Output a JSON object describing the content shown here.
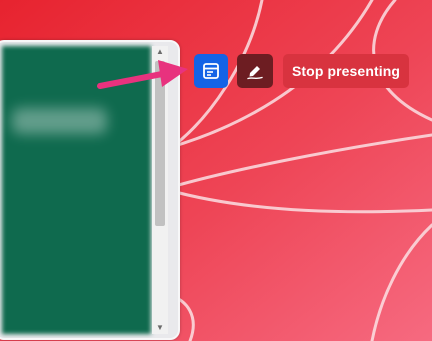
{
  "toolbar": {
    "notes_icon": "speaker-notes-icon",
    "annotate_icon": "annotate-pen-icon",
    "stop_label": "Stop presenting"
  },
  "preview": {
    "scroll_up_glyph": "▲",
    "scroll_down_glyph": "▼"
  },
  "colors": {
    "background_gradient_start": "#e7232f",
    "background_gradient_end": "#f66a80",
    "notes_button": "#1463e6",
    "annotate_button": "#6d1d22",
    "stop_button": "#d8333f",
    "pointer_arrow": "#e8327e",
    "preview_slide": "#0f6a4e"
  }
}
